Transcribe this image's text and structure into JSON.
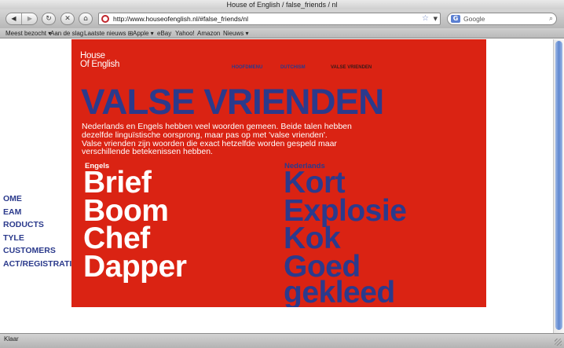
{
  "window": {
    "title": "House of English / false_friends / nl"
  },
  "toolbar": {
    "back_icon": "back-arrow-icon",
    "forward_icon": "forward-arrow-icon",
    "reload_icon": "reload-icon",
    "stop_icon": "stop-icon",
    "home_icon": "home-icon",
    "url": "http://www.houseofenglish.nl/#false_friends/nl",
    "search_placeholder": "Google"
  },
  "bookmarks": [
    "Meest bezocht ▾",
    "Aan de slag",
    "Laatste nieuws ⊞",
    "Apple ▾",
    "eBay",
    "Yahoo!",
    "Amazon",
    "Nieuws ▾"
  ],
  "sidenav": [
    "OME",
    "EAM",
    "RODUCTS",
    "TYLE",
    "CUSTOMERS",
    "ACT/REGISTRATI"
  ],
  "site": {
    "logo_line1": "House",
    "logo_line2": "Of English",
    "menu": [
      "HOOFDMENU",
      "DUTCHISM",
      "VALSE VRIENDEN"
    ],
    "active_menu": "VALSE VRIENDEN",
    "headline": "VALSE VRIENDEN",
    "intro_lines": [
      "Nederlands en Engels hebben veel woorden gemeen. Beide talen hebben",
      "dezelfde linguïstische oorsprong, maar pas op met 'valse vrienden'.",
      "Valse vrienden zijn woorden die exact hetzelfde worden gespeld maar",
      "verschillende betekenissen hebben."
    ],
    "english_header": "Engels",
    "dutch_header": "Nederlands",
    "english_words": [
      "Brief",
      "Boom",
      "Chef",
      "Dapper"
    ],
    "dutch_words": [
      "Kort",
      "Explosie",
      "Kok",
      "Goed",
      "gekleed"
    ]
  },
  "statusbar": {
    "text": "Klaar"
  },
  "colors": {
    "panel_red": "#da2313",
    "navy": "#2b3a8c",
    "white": "#ffffff"
  }
}
